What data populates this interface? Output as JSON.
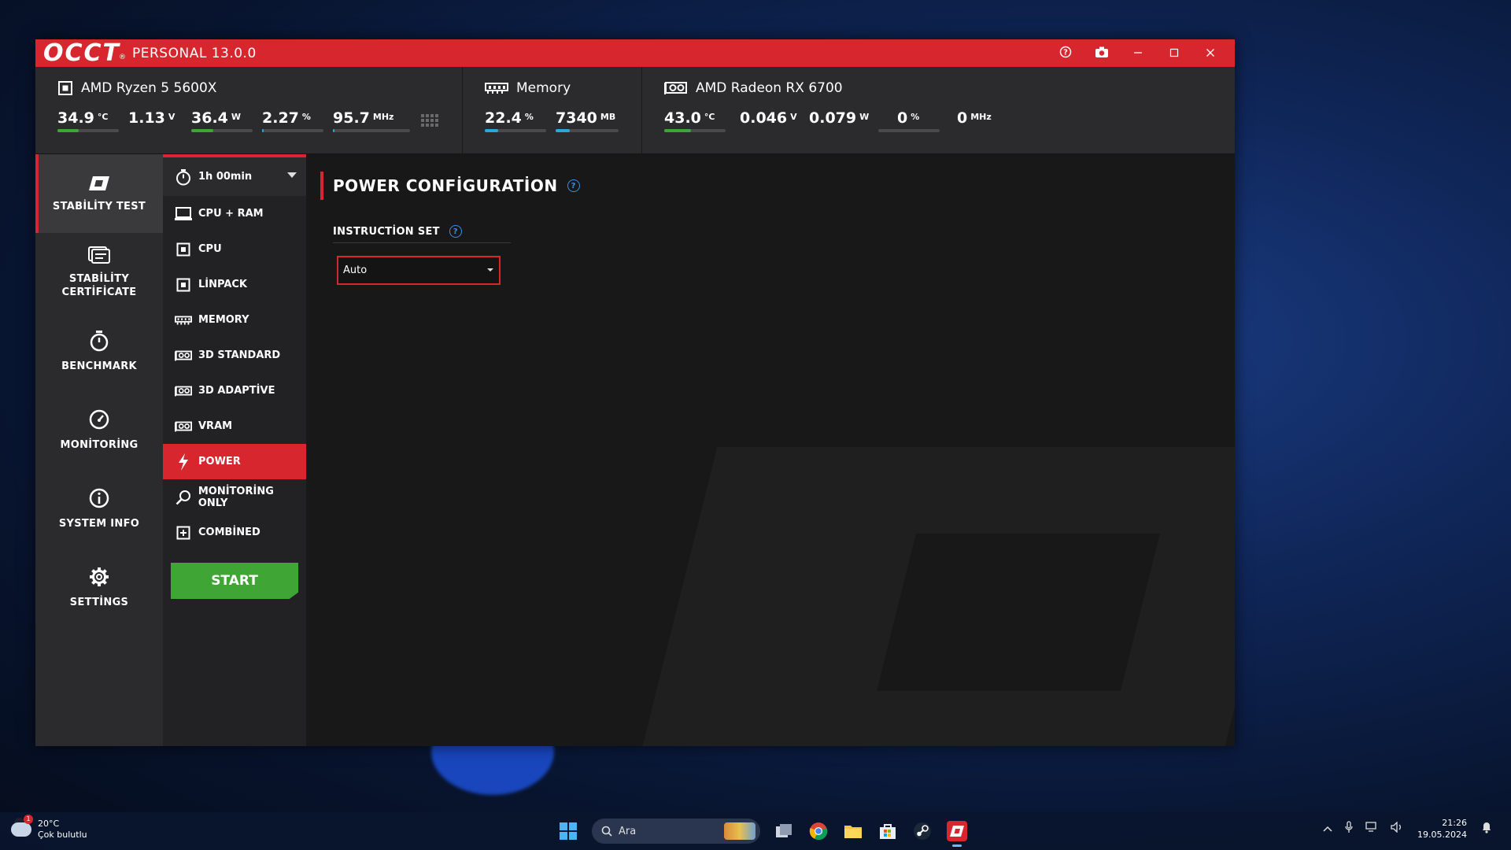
{
  "window": {
    "logo": "OCCT",
    "logo_mark": "®",
    "edition": "PERSONAL 13.0.0"
  },
  "sensors": {
    "cpu": {
      "name": "AMD Ryzen 5 5600X",
      "metrics": [
        {
          "value": "34.9",
          "unit": "°C",
          "fill": 0.35,
          "color": "#3fa535"
        },
        {
          "value": "1.13",
          "unit": "V",
          "fill": 0.0,
          "color": "#3fa535"
        },
        {
          "value": "36.4",
          "unit": "W",
          "fill": 0.36,
          "color": "#3fa535"
        },
        {
          "value": "2.27",
          "unit": "%",
          "fill": 0.02,
          "color": "#2aa9d6"
        },
        {
          "value": "95.7",
          "unit": "MHz",
          "fill": 0.02,
          "color": "#2aa9d6"
        }
      ]
    },
    "memory": {
      "name": "Memory",
      "metrics": [
        {
          "value": "22.4",
          "unit": "%",
          "fill": 0.22,
          "color": "#2aa9d6"
        },
        {
          "value": "7340",
          "unit": "MB",
          "fill": 0.22,
          "color": "#2aa9d6"
        }
      ]
    },
    "gpu": {
      "name": "AMD Radeon RX 6700",
      "metrics": [
        {
          "value": "43.0",
          "unit": "°C",
          "fill": 0.43,
          "color": "#3fa535"
        },
        {
          "value": "0.046",
          "unit": "V",
          "fill": 0.0,
          "color": "#3fa535"
        },
        {
          "value": "0.079",
          "unit": "W",
          "fill": 0.0,
          "color": "#3fa535"
        },
        {
          "value": "0",
          "unit": "%",
          "fill": 0.0,
          "color": "#2aa9d6"
        },
        {
          "value": "0",
          "unit": "MHz",
          "fill": 0.0,
          "color": "#2aa9d6"
        }
      ]
    }
  },
  "nav": {
    "items": [
      {
        "label": "STABİLİTY TEST",
        "icon": "occt-logo-icon",
        "active": true
      },
      {
        "label": "STABİLİTY CERTİFİCATE",
        "icon": "certificate-icon",
        "active": false
      },
      {
        "label": "BENCHMARK",
        "icon": "stopwatch-icon",
        "active": false
      },
      {
        "label": "MONİTORİNG",
        "icon": "gauge-icon",
        "active": false
      },
      {
        "label": "SYSTEM INFO",
        "icon": "info-icon",
        "active": false
      },
      {
        "label": "SETTİNGS",
        "icon": "gear-icon",
        "active": false
      }
    ]
  },
  "tests": {
    "duration": "1h 00min",
    "items": [
      {
        "label": "CPU + RAM",
        "icon": "monitor-icon"
      },
      {
        "label": "CPU",
        "icon": "chip-icon"
      },
      {
        "label": "LİNPACK",
        "icon": "chip-icon"
      },
      {
        "label": "MEMORY",
        "icon": "memory-icon"
      },
      {
        "label": "3D STANDARD",
        "icon": "gpu-icon"
      },
      {
        "label": "3D ADAPTİVE",
        "icon": "gpu-icon"
      },
      {
        "label": "VRAM",
        "icon": "gpu-icon"
      },
      {
        "label": "POWER",
        "icon": "lightning-icon",
        "active": true
      },
      {
        "label": "MONİTORİNG ONLY",
        "icon": "magnifier-icon"
      },
      {
        "label": "COMBİNED",
        "icon": "plus-box-icon"
      }
    ],
    "start_label": "START"
  },
  "content": {
    "title": "POWER CONFİGURATİON",
    "help": "?",
    "field_label": "INSTRUCTİON SET",
    "select_value": "Auto"
  },
  "taskbar": {
    "weather_temp": "20°C",
    "weather_desc": "Çok bulutlu",
    "weather_badge": "1",
    "search_placeholder": "Ara",
    "time": "21:26",
    "date": "19.05.2024"
  },
  "colors": {
    "accent": "#d8262e",
    "start": "#3fa535",
    "help": "#3d8fe0"
  }
}
